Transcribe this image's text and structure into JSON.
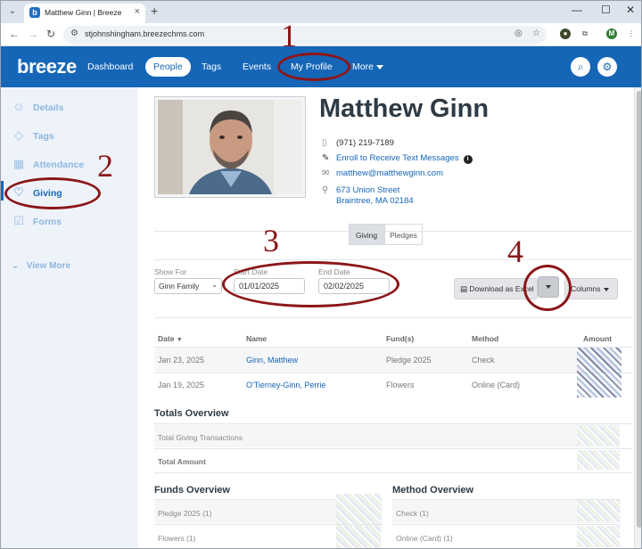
{
  "browser": {
    "tab_title": "Matthew Ginn | Breeze",
    "favicon_letter": "b",
    "url": "stjohnshingham.breezechms.com",
    "profile_initial": "M"
  },
  "app": {
    "logo": "breeze",
    "nav": [
      {
        "label": "Dashboard"
      },
      {
        "label": "People"
      },
      {
        "label": "Tags"
      },
      {
        "label": "Events"
      },
      {
        "label": "My Profile"
      },
      {
        "label": "More"
      }
    ],
    "accent_color": "#1566b7"
  },
  "sidebar": {
    "items": [
      {
        "label": "Details",
        "icon": "person-icon"
      },
      {
        "label": "Tags",
        "icon": "tag-icon"
      },
      {
        "label": "Attendance",
        "icon": "calendar-icon"
      },
      {
        "label": "Giving",
        "icon": "hand-heart-icon"
      },
      {
        "label": "Forms",
        "icon": "checkbox-icon"
      }
    ],
    "view_more": "View More"
  },
  "profile": {
    "name": "Matthew Ginn",
    "phone": "(971) 219-7189",
    "text_link": "Enroll to Receive Text Messages",
    "email": "matthew@matthewginn.com",
    "address_line1": "673 Union Street",
    "address_line2": "Braintree, MA 02184"
  },
  "tabs": {
    "giving": "Giving",
    "pledges": "Pledges"
  },
  "filters": {
    "show_for_label": "Show For",
    "show_for_value": "Ginn Family",
    "start_label": "Start Date",
    "start_value": "01/01/2025",
    "end_label": "End Date",
    "end_value": "02/02/2025",
    "download_label": "Download as Excel",
    "columns_label": "Columns"
  },
  "table": {
    "headers": [
      "Date",
      "Name",
      "Fund(s)",
      "Method",
      "Amount"
    ],
    "rows": [
      {
        "date": "Jan 23, 2025",
        "name": "Ginn, Matthew",
        "fund": "Pledge 2025",
        "method": "Check"
      },
      {
        "date": "Jan 19, 2025",
        "name": "O'Tierney-Ginn, Perrie",
        "fund": "Flowers",
        "method": "Online (Card)"
      }
    ]
  },
  "totals": {
    "title": "Totals Overview",
    "transactions_label": "Total Giving Transactions",
    "amount_label": "Total Amount"
  },
  "funds": {
    "title": "Funds Overview",
    "items": [
      "Pledge 2025 (1)",
      "Flowers (1)"
    ]
  },
  "methods": {
    "title": "Method Overview",
    "items": [
      "Check (1)",
      "Online (Card) (1)"
    ]
  },
  "annotations": [
    "1",
    "2",
    "3",
    "4"
  ],
  "annotation_color": "#8c1618"
}
